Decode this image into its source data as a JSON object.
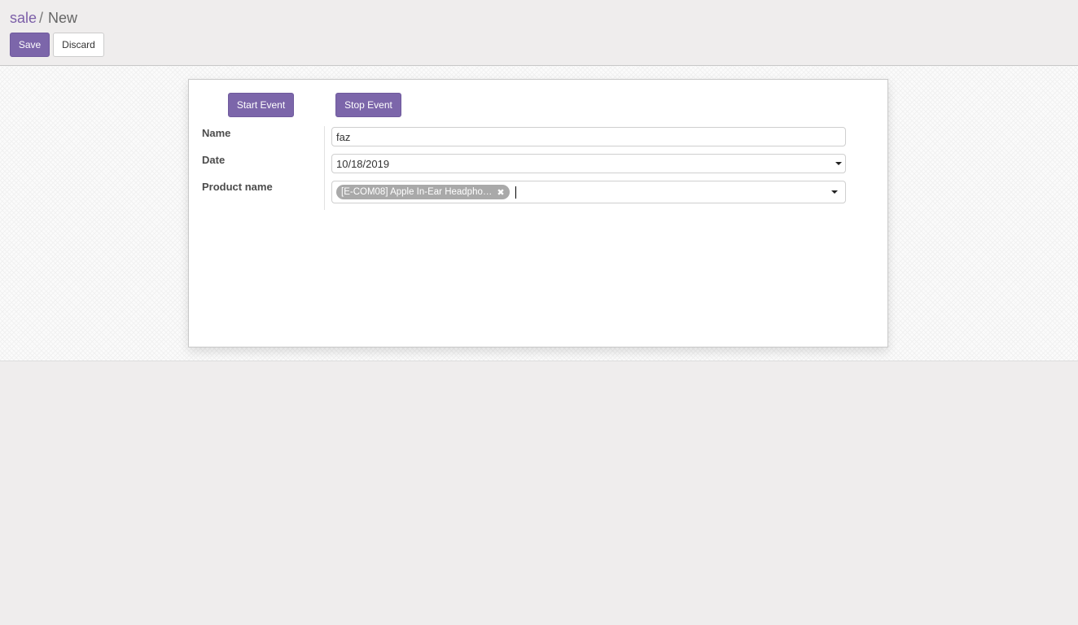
{
  "breadcrumb": {
    "parent": "sale",
    "separator": "/",
    "current": "New"
  },
  "toolbar": {
    "save_label": "Save",
    "discard_label": "Discard"
  },
  "header_buttons": {
    "start_event": "Start Event",
    "stop_event": "Stop Event"
  },
  "form": {
    "name": {
      "label": "Name",
      "value": "faz"
    },
    "date": {
      "label": "Date",
      "value": "10/18/2019"
    },
    "product": {
      "label": "Product name",
      "tags": [
        "[E-COM08] Apple In-Ear Headpho…"
      ]
    }
  },
  "colors": {
    "primary": "#7c66aa",
    "link": "#7c5fa8",
    "background": "#efeded",
    "tag": "#a9a9a9"
  },
  "icons": {
    "tag_remove": "close-icon",
    "dropdown": "caret-down-icon"
  }
}
